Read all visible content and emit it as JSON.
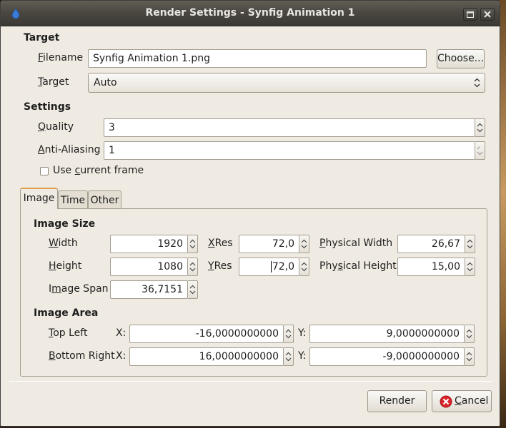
{
  "window": {
    "title": "Render Settings - Synfig Animation 1"
  },
  "target": {
    "heading": "Target",
    "filename_label": "Filename",
    "filename_value": "Synfig Animation 1.png",
    "choose_label": "Choose...",
    "target_label": "Target",
    "target_value": "Auto"
  },
  "settings": {
    "heading": "Settings",
    "quality_label": "Quality",
    "quality_value": "3",
    "antialias_label": "Anti-Aliasing",
    "antialias_value": "1",
    "use_current_frame_label": "Use current frame",
    "use_current_frame_checked": false
  },
  "tabs": [
    {
      "label": "Image",
      "active": true
    },
    {
      "label": "Time",
      "active": false
    },
    {
      "label": "Other",
      "active": false
    }
  ],
  "image_size": {
    "heading": "Image Size",
    "width_label": "Width",
    "width_value": "1920",
    "height_label": "Height",
    "height_value": "1080",
    "xres_label": "XRes",
    "xres_value": "72,0",
    "yres_label": "YRes",
    "yres_value": "72,0",
    "physical_width_label": "Physical Width",
    "physical_width_value": "26,67",
    "physical_height_label": "Physical Height",
    "physical_height_value": "15,00",
    "image_span_label": "Image Span",
    "image_span_value": "36,7151"
  },
  "image_area": {
    "heading": "Image Area",
    "top_left_label": "Top Left",
    "bottom_right_label": "Bottom Right",
    "x_label": "X:",
    "y_label": "Y:",
    "top_left_x": "-16,0000000000",
    "top_left_y": "9,0000000000",
    "bottom_right_x": "16,0000000000",
    "bottom_right_y": "-9,0000000000"
  },
  "buttons": {
    "render_label": "Render",
    "cancel_label": "Cancel"
  },
  "colors": {
    "cancel_icon": "#d9262c",
    "active_tab_accent": "#e0a050",
    "titlebar": "#4b4842"
  }
}
